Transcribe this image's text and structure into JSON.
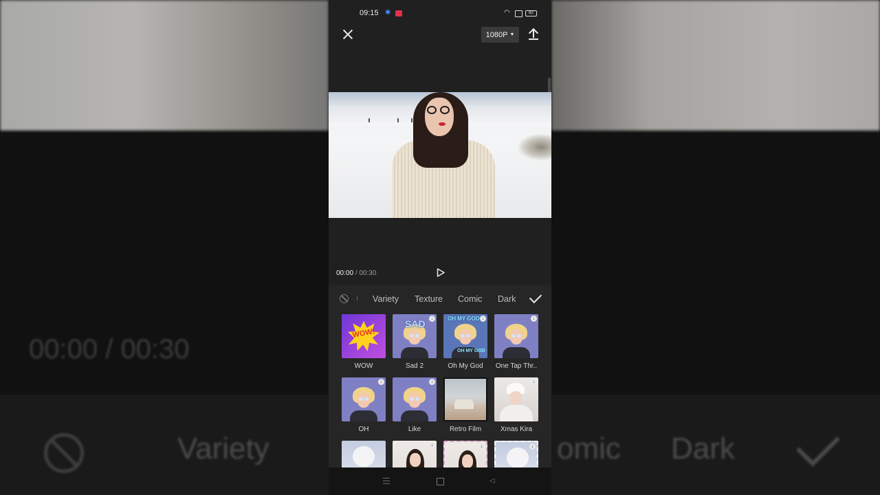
{
  "status_bar": {
    "time": "09:15",
    "battery": "82"
  },
  "toolbar": {
    "resolution": "1080P"
  },
  "player": {
    "current_time": "00:00",
    "separator": "/",
    "duration": "00:30"
  },
  "effects": {
    "categories": [
      "Variety",
      "Texture",
      "Comic",
      "Dark"
    ],
    "items": [
      {
        "label": "WOW"
      },
      {
        "label": "Sad 2"
      },
      {
        "label": "Oh My God"
      },
      {
        "label": "One Tap Thr.."
      },
      {
        "label": "OH"
      },
      {
        "label": "Like"
      },
      {
        "label": "Retro Film"
      },
      {
        "label": "Xmas Kira"
      }
    ],
    "thumb_text": {
      "wow": "WOW!",
      "sad": "SAD",
      "omg_top": "OH MY GOD",
      "omg_bottom": "OH MY GOD"
    }
  },
  "background_overlay": {
    "time": "00:00 / 00:30",
    "tabs": [
      "Variety",
      "omic",
      "Dark"
    ]
  },
  "colors": {
    "accent": "#3d8bff",
    "panel": "#262626",
    "thumb_purple": "#7f80c4"
  },
  "icons": [
    "close-icon",
    "export-icon",
    "play-icon",
    "none-icon",
    "check-icon",
    "download-icon",
    "menu-icon",
    "home-icon",
    "back-icon"
  ]
}
